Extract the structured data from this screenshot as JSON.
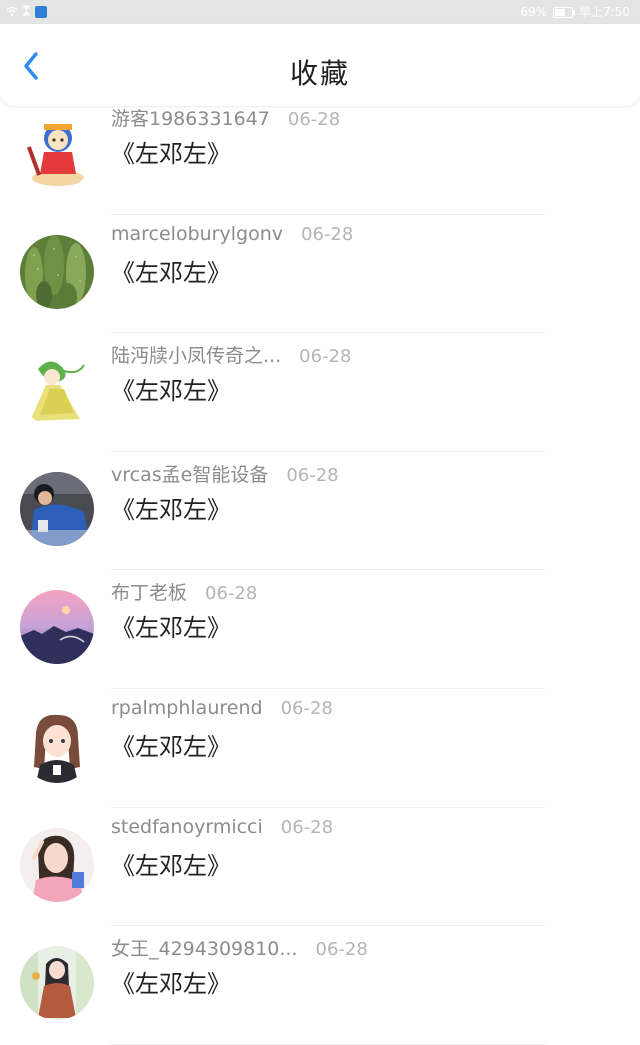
{
  "status_bar": {
    "battery_text": "69%",
    "time": "早上7:50",
    "icons": [
      "wifi-icon",
      "hourglass-icon",
      "app-notification-icon",
      "battery-icon"
    ]
  },
  "header": {
    "title": "收藏",
    "back_icon": "chevron-left-icon",
    "accent_color": "#2a8bf2"
  },
  "items": [
    {
      "username": "游客1986331647",
      "date": "06-28",
      "title": "《左邓左》",
      "avatar": "cartoon-character"
    },
    {
      "username": "marceloburylgonv",
      "date": "06-28",
      "title": "《左邓左》",
      "avatar": "cactus-photo"
    },
    {
      "username": "陆沔牍小凤传奇之...",
      "date": "06-28",
      "title": "《左邓左》",
      "avatar": "green-hair-anime-figure"
    },
    {
      "username": "vrcas孟e智能设备",
      "date": "06-28",
      "title": "《左邓左》",
      "avatar": "person-photo"
    },
    {
      "username": "布丁老板",
      "date": "06-28",
      "title": "《左邓左》",
      "avatar": "sunset-sky-photo"
    },
    {
      "username": "rpalmphlaurend",
      "date": "06-28",
      "title": "《左邓左》",
      "avatar": "anime-girl"
    },
    {
      "username": "stedfanoyrmicci",
      "date": "06-28",
      "title": "《左邓左》",
      "avatar": "woman-selfie"
    },
    {
      "username": "女王_4294309810...",
      "date": "06-28",
      "title": "《左邓左》",
      "avatar": "illustrated-girl"
    }
  ]
}
